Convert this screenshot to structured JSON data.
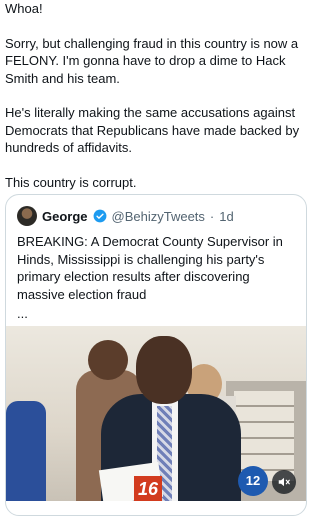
{
  "post": {
    "paragraphs": [
      "Whoa!",
      "Sorry, but challenging fraud in this country is now a FELONY. I'm gonna have to drop a dime to Hack Smith and his team.",
      "He's literally making the same accusations against Democrats that Republicans have made backed by hundreds of affidavits.",
      "This country is corrupt."
    ]
  },
  "quote": {
    "name": "George",
    "handle": "@BehizyTweets",
    "separator": "·",
    "time": "1d",
    "text": "BREAKING: A Democrat County Supervisor in Hinds, Mississippi is challenging his party's primary election results after discovering massive election fraud",
    "ellipsis": "..."
  },
  "video": {
    "station_badge_left": "16",
    "station_badge_right": "12",
    "controls": {
      "mute_icon": "volume-muted-icon"
    }
  },
  "colors": {
    "verified": "#1d9bf0",
    "border": "#cfd9de",
    "muted_text": "#536471"
  }
}
